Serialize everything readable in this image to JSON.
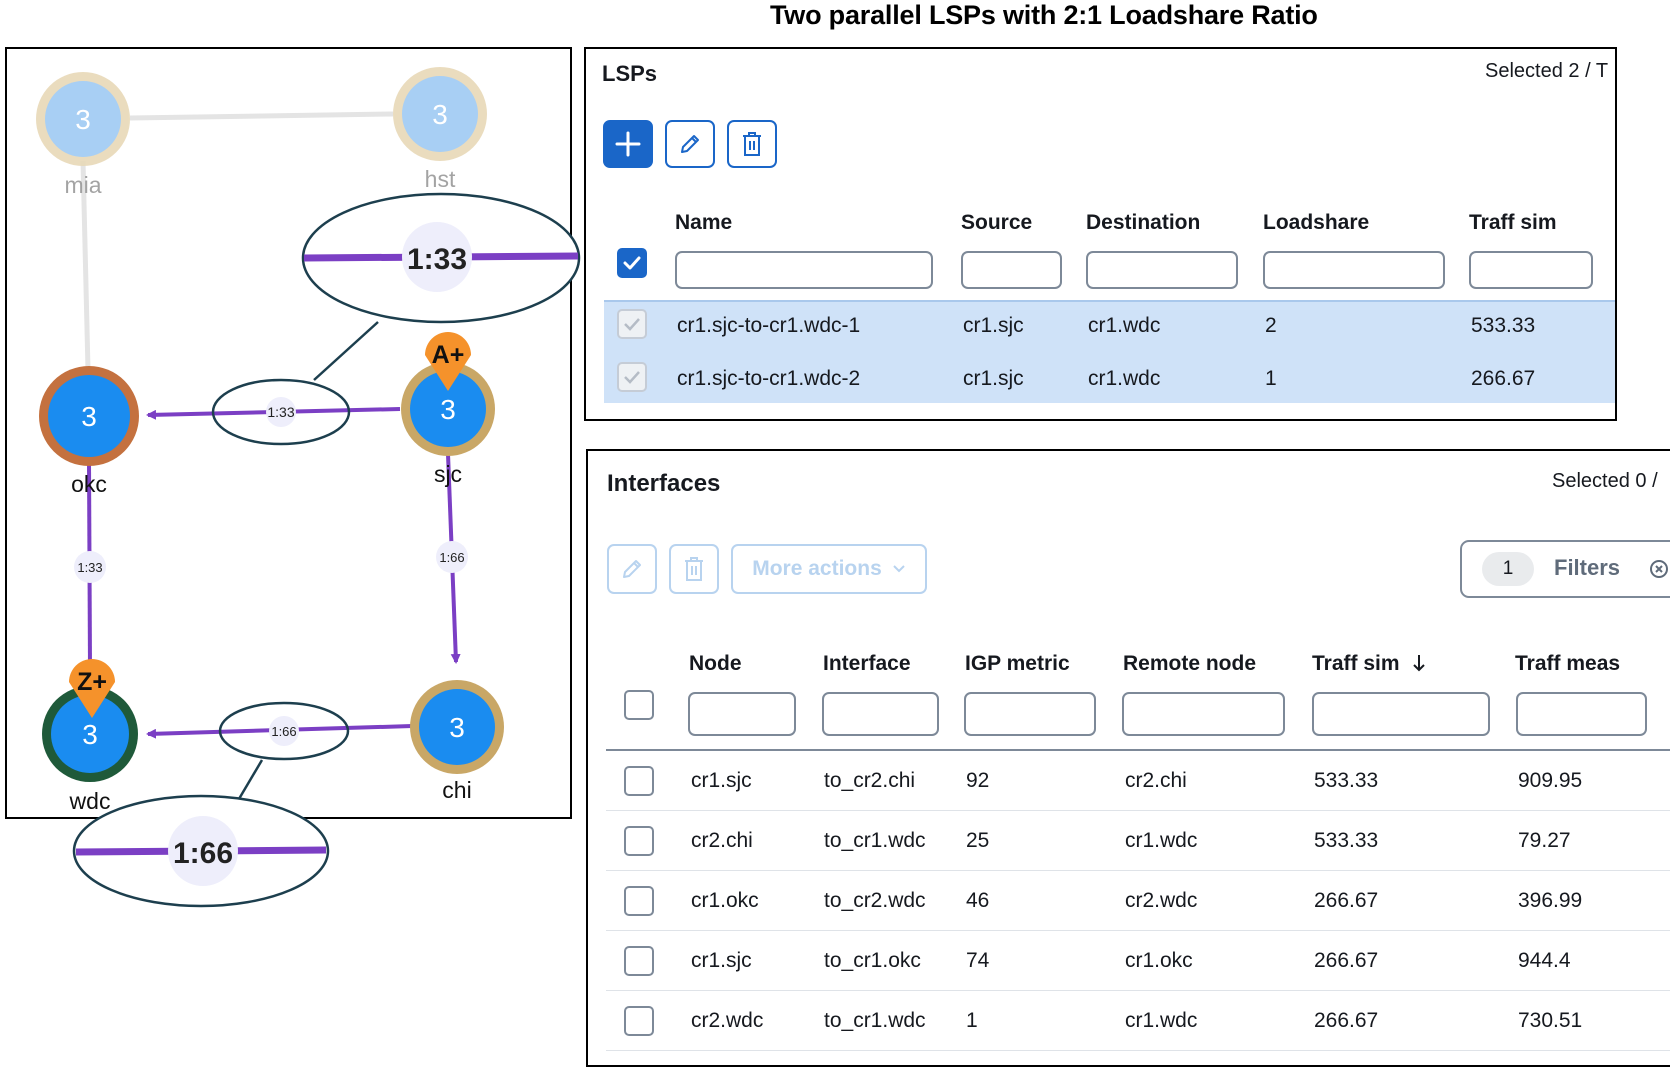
{
  "title": "Two parallel LSPs with 2:1 Loadshare Ratio",
  "topology": {
    "nodes": [
      {
        "id": "mia",
        "label": "mia",
        "count": "3",
        "ring": "#e8d9b8",
        "fill": "#9fcaf3",
        "faded": true
      },
      {
        "id": "hst",
        "label": "hst",
        "count": "3",
        "ring": "#e8d9b8",
        "fill": "#9fcaf3",
        "faded": true
      },
      {
        "id": "okc",
        "label": "okc",
        "count": "3",
        "ring": "#c4713f",
        "fill": "#1a8cf0",
        "faded": false
      },
      {
        "id": "sjc",
        "label": "sjc",
        "count": "3",
        "ring": "#c9a766",
        "fill": "#1a8cf0",
        "faded": false
      },
      {
        "id": "wdc",
        "label": "wdc",
        "count": "3",
        "ring": "#1f5a3a",
        "fill": "#1a8cf0",
        "faded": false
      },
      {
        "id": "chi",
        "label": "chi",
        "count": "3",
        "ring": "#c9a766",
        "fill": "#1a8cf0",
        "faded": false
      }
    ],
    "markers": [
      {
        "node": "sjc",
        "label": "A+"
      },
      {
        "node": "wdc",
        "label": "Z+"
      }
    ],
    "link_labels": {
      "sjc_okc": "1:33",
      "okc_wdc": "1:33",
      "sjc_chi": "1:66",
      "chi_wdc": "1:66"
    },
    "zoom_callouts": [
      "1:33",
      "1:66"
    ],
    "colors": {
      "link": "#7b3fc4",
      "faded_link": "#e4e4e4",
      "callout_border": "#1d3f4e",
      "marker": "#f5922b"
    }
  },
  "lsps": {
    "title": "LSPs",
    "selected_text": "Selected 2 / T",
    "toolbar": {
      "add_icon": "plus-icon",
      "edit_icon": "pencil-icon",
      "delete_icon": "trash-icon"
    },
    "columns": [
      "Name",
      "Source",
      "Destination",
      "Loadshare",
      "Traff sim"
    ],
    "rows": [
      {
        "name": "cr1.sjc-to-cr1.wdc-1",
        "source": "cr1.sjc",
        "destination": "cr1.wdc",
        "loadshare": "2",
        "traff_sim": "533.33"
      },
      {
        "name": "cr1.sjc-to-cr1.wdc-2",
        "source": "cr1.sjc",
        "destination": "cr1.wdc",
        "loadshare": "1",
        "traff_sim": "266.67"
      }
    ]
  },
  "interfaces": {
    "title": "Interfaces",
    "selected_text": "Selected 0 /",
    "more_actions": "More actions",
    "filters_count": "1",
    "filters_label": "Filters",
    "columns": [
      "Node",
      "Interface",
      "IGP metric",
      "Remote node",
      "Traff sim",
      "Traff meas"
    ],
    "rows": [
      {
        "node": "cr1.sjc",
        "interface": "to_cr2.chi",
        "igp": "92",
        "remote": "cr2.chi",
        "sim": "533.33",
        "meas": "909.95"
      },
      {
        "node": "cr2.chi",
        "interface": "to_cr1.wdc",
        "igp": "25",
        "remote": "cr1.wdc",
        "sim": "533.33",
        "meas": "79.27"
      },
      {
        "node": "cr1.okc",
        "interface": "to_cr2.wdc",
        "igp": "46",
        "remote": "cr2.wdc",
        "sim": "266.67",
        "meas": "396.99"
      },
      {
        "node": "cr1.sjc",
        "interface": "to_cr1.okc",
        "igp": "74",
        "remote": "cr1.okc",
        "sim": "266.67",
        "meas": "944.4"
      },
      {
        "node": "cr2.wdc",
        "interface": "to_cr1.wdc",
        "igp": "1",
        "remote": "cr1.wdc",
        "sim": "266.67",
        "meas": "730.51"
      }
    ]
  }
}
